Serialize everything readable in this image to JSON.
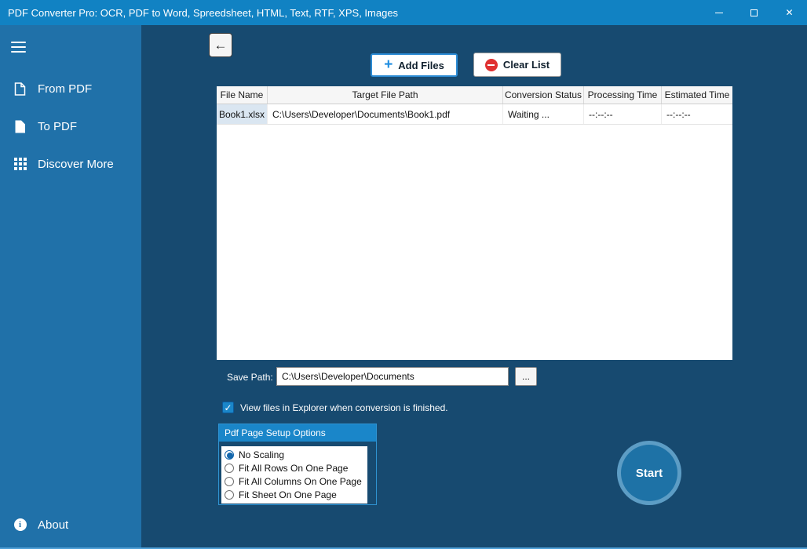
{
  "window": {
    "title": "PDF Converter Pro: OCR, PDF to Word, Spreedsheet, HTML, Text, RTF, XPS, Images"
  },
  "icons": {
    "close": "✕",
    "back_arrow": "←",
    "add_plus": "+"
  },
  "sidebar": {
    "items": [
      {
        "label": "From PDF",
        "selected": false
      },
      {
        "label": "To PDF",
        "selected": true
      },
      {
        "label": "Discover More",
        "selected": false
      }
    ],
    "about_label": "About"
  },
  "toolbar": {
    "add_files_label": "Add Files",
    "clear_list_label": "Clear List"
  },
  "table": {
    "headers": [
      "File Name",
      "Target File Path",
      "Conversion Status",
      "Processing Time",
      "Estimated Time"
    ],
    "rows": [
      {
        "file_name": "Book1.xlsx",
        "target_path": "C:\\Users\\Developer\\Documents\\Book1.pdf",
        "status": "Waiting ...",
        "processing_time": "--:--:--",
        "estimated_time": "--:--:--"
      }
    ]
  },
  "save_path": {
    "label": "Save Path:",
    "value": "C:\\Users\\Developer\\Documents",
    "browse_label": "..."
  },
  "options": {
    "view_files_label": "View files in Explorer when conversion is finished.",
    "view_files_checked": true,
    "group_title": "Pdf Page Setup Options",
    "radios": [
      {
        "label": "No Scaling",
        "selected": true
      },
      {
        "label": "Fit All Rows On One Page",
        "selected": false
      },
      {
        "label": "Fit All Columns On One Page",
        "selected": false
      },
      {
        "label": "Fit Sheet On One Page",
        "selected": false
      }
    ]
  },
  "start_label": "Start",
  "colors": {
    "titlebar": "#1182c3",
    "sidebar": "#2071a9",
    "main": "#174a70",
    "accent": "#1a86c9",
    "danger": "#e03131",
    "startfill": "#1e72a6",
    "selectedcell": "#dae6f1"
  }
}
